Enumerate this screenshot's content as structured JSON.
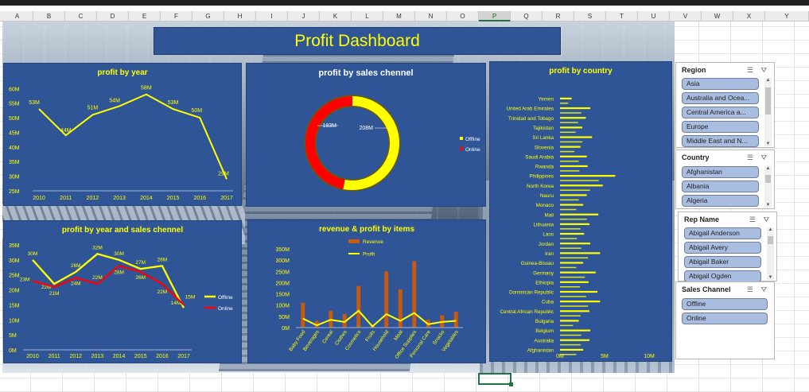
{
  "sheet": {
    "columns": [
      "A",
      "B",
      "C",
      "D",
      "E",
      "F",
      "G",
      "H",
      "I",
      "J",
      "K",
      "L",
      "M",
      "N",
      "O",
      "P",
      "Q",
      "R",
      "S",
      "T",
      "U",
      "V",
      "W",
      "X",
      "Y"
    ],
    "selected_column": "P"
  },
  "dashboard": {
    "title": "Profit Dashboard"
  },
  "chart_data": [
    {
      "id": "profit_by_year",
      "type": "line",
      "title": "profit by year",
      "categories": [
        "2010",
        "2011",
        "2012",
        "2013",
        "2014",
        "2015",
        "2016",
        "2017"
      ],
      "series": [
        {
          "values": [
            53,
            44,
            51,
            54,
            58,
            53,
            50,
            29
          ]
        }
      ],
      "data_labels": [
        "53M",
        "44M",
        "51M",
        "54M",
        "58M",
        "53M",
        "50M",
        "29M"
      ],
      "yticks": [
        "25M",
        "30M",
        "35M",
        "40M",
        "45M",
        "50M",
        "55M",
        "60M"
      ],
      "ylim": [
        25,
        62
      ],
      "color": "#ffff00"
    },
    {
      "id": "profit_by_sales_channel",
      "type": "pie",
      "title": "profit by sales chennel",
      "slices": [
        {
          "name": "Offline",
          "value": 208,
          "label": "208M",
          "color": "#ffff00"
        },
        {
          "name": "Online",
          "value": 183,
          "label": "183M",
          "color": "#ff0000"
        }
      ],
      "legend": "right"
    },
    {
      "id": "profit_by_country",
      "type": "bar",
      "title": "profit by country",
      "categories": [
        "Yemen",
        "United Arab Emirates",
        "Trinidad and Tobago",
        "Tajikistan",
        "Sri Lanka",
        "Slovenia",
        "Saudi Arabia",
        "Rwanda",
        "Philippines",
        "North Korea",
        "Nauru",
        "Monaco",
        "Mali",
        "Lithuania",
        "Laos",
        "Jordan",
        "Iran",
        "Guinea-Bissau",
        "Germany",
        "Ethiopia",
        "Dominican Republic",
        "Cuba",
        "Central African Republic",
        "Bulgaria",
        "Belgium",
        "Australia",
        "Afghanistan"
      ],
      "values": [
        1.3,
        3.4,
        2.9,
        2.5,
        3.6,
        2.3,
        3.0,
        3.1,
        6.2,
        4.8,
        3.0,
        2.6,
        4.3,
        3.3,
        2.7,
        3.4,
        4.5,
        2.6,
        4.0,
        3.2,
        4.2,
        4.5,
        3.3,
        2.1,
        3.4,
        3.3,
        2.6
      ],
      "xticks": [
        "0M",
        "5M",
        "10M"
      ],
      "xlim": [
        0,
        10
      ],
      "color": "#ffff00"
    },
    {
      "id": "profit_by_year_and_sales_channel",
      "type": "line",
      "title": "profit by year and sales chennel",
      "categories": [
        "2010",
        "2011",
        "2012",
        "2013",
        "2014",
        "2015",
        "2016",
        "2017"
      ],
      "series": [
        {
          "name": "Offline",
          "values": [
            30,
            22,
            26,
            32,
            30,
            27,
            28,
            14
          ],
          "labels": [
            "30M",
            "22M",
            "26M",
            "32M",
            "30M",
            "27M",
            "28M",
            "14M"
          ],
          "color": "#ffff00"
        },
        {
          "name": "Online",
          "values": [
            23,
            21,
            24,
            22,
            28,
            26,
            22,
            15
          ],
          "labels": [
            "23M",
            "21M",
            "24M",
            "22M",
            "28M",
            "26M",
            "22M",
            "15M"
          ],
          "color": "#ff0000"
        }
      ],
      "yticks": [
        "0M",
        "5M",
        "10M",
        "15M",
        "20M",
        "25M",
        "30M",
        "35M"
      ],
      "ylim": [
        0,
        35
      ],
      "legend": "right"
    },
    {
      "id": "revenue_profit_by_items",
      "type": "bar",
      "title": "revenue & profit by items",
      "categories": [
        "Baby Food",
        "Beverages",
        "Cereal",
        "Clothes",
        "Cosmetics",
        "Fruits",
        "Household",
        "Meat",
        "Office Supplies",
        "Personal Care",
        "Snacks",
        "Vegetables"
      ],
      "series": [
        {
          "name": "Revenue",
          "kind": "bar",
          "values": [
            110,
            30,
            75,
            60,
            185,
            15,
            250,
            170,
            295,
            35,
            55,
            70
          ],
          "color": "#c55a11"
        },
        {
          "name": "Profit",
          "kind": "line",
          "values": [
            40,
            10,
            35,
            25,
            75,
            5,
            60,
            30,
            65,
            15,
            25,
            30
          ],
          "color": "#ffff00"
        }
      ],
      "yticks": [
        "0M",
        "50M",
        "100M",
        "150M",
        "200M",
        "250M",
        "300M",
        "350M"
      ],
      "ylim": [
        0,
        350
      ],
      "legend": "top"
    }
  ],
  "slicers": {
    "region": {
      "title": "Region",
      "items": [
        "Asia",
        "Australia and Ocea...",
        "Central America a...",
        "Europe",
        "Middle East and N..."
      ]
    },
    "country": {
      "title": "Country",
      "items": [
        "Afghanistan",
        "Albania",
        "Algeria"
      ]
    },
    "rep_name": {
      "title": "Rep Name",
      "items": [
        "Abigail Anderson",
        "Abigail Avery",
        "Abigail Baker",
        "Abigail Ogden"
      ]
    },
    "sales_channel": {
      "title": "Sales Channel",
      "items": [
        "Offline",
        "Online"
      ]
    }
  }
}
